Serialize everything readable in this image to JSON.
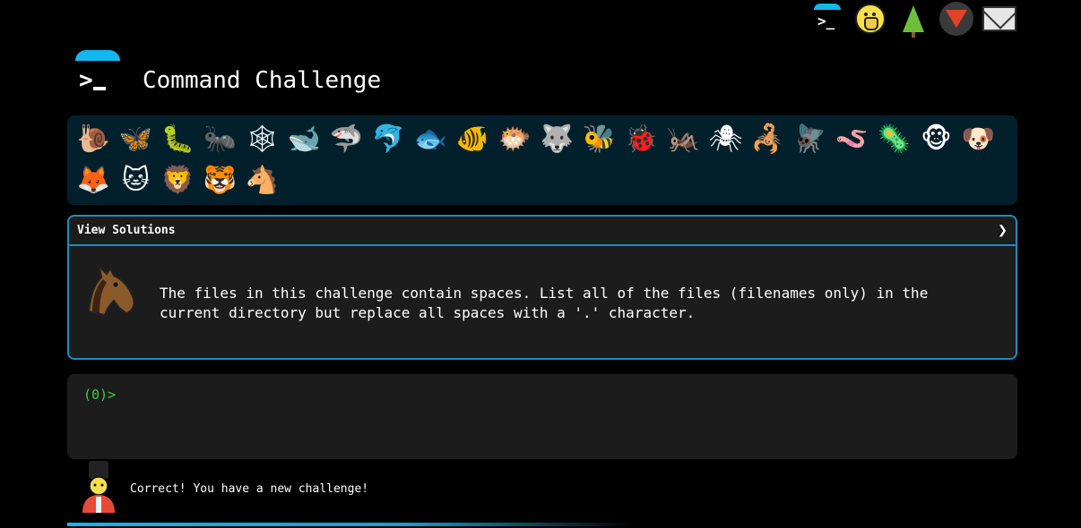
{
  "top_icons": [
    {
      "name": "terminal-icon",
      "label": ">_"
    },
    {
      "name": "shushing-face-icon"
    },
    {
      "name": "tree-icon"
    },
    {
      "name": "gitlab-icon"
    },
    {
      "name": "mail-icon"
    }
  ],
  "header": {
    "title": "Command Challenge",
    "logo_prompt": ">"
  },
  "animals": [
    {
      "name": "snail-icon",
      "glyph": "🐌"
    },
    {
      "name": "butterfly-icon",
      "glyph": "🦋"
    },
    {
      "name": "caterpillar-icon",
      "glyph": "🐛"
    },
    {
      "name": "ant-icon",
      "glyph": "🐜"
    },
    {
      "name": "spider-web-icon",
      "glyph": "🕸"
    },
    {
      "name": "whale-icon",
      "glyph": "🐋"
    },
    {
      "name": "shark-icon",
      "glyph": "🦈"
    },
    {
      "name": "dolphin-icon",
      "glyph": "🐬"
    },
    {
      "name": "fish-icon",
      "glyph": "🐟"
    },
    {
      "name": "tropical-fish-icon",
      "glyph": "🐠"
    },
    {
      "name": "blowfish-icon",
      "glyph": "🐡"
    },
    {
      "name": "wolf-icon",
      "glyph": "🐺"
    },
    {
      "name": "bee-icon",
      "glyph": "🐝"
    },
    {
      "name": "ladybug-icon",
      "glyph": "🐞"
    },
    {
      "name": "cricket-icon",
      "glyph": "🦗"
    },
    {
      "name": "spider-icon",
      "glyph": "🕷"
    },
    {
      "name": "scorpion-icon",
      "glyph": "🦂"
    },
    {
      "name": "fly-icon",
      "glyph": "🪰"
    },
    {
      "name": "worm-icon",
      "glyph": "🪱"
    },
    {
      "name": "microbe-icon",
      "glyph": "🦠"
    },
    {
      "name": "monkey-icon",
      "glyph": "🐵"
    },
    {
      "name": "dog-icon",
      "glyph": "🐶"
    },
    {
      "name": "fox-icon",
      "glyph": "🦊"
    },
    {
      "name": "cat-icon",
      "glyph": "🐱"
    },
    {
      "name": "lion-icon",
      "glyph": "🦁"
    },
    {
      "name": "tiger-icon",
      "glyph": "🐯"
    },
    {
      "name": "horse-icon",
      "glyph": "🐴"
    }
  ],
  "challenge": {
    "view_solutions_label": "View Solutions",
    "chevron": "❯",
    "text": "The files in this challenge contain spaces. List all of the files (filenames only) in the current directory but replace all spaces with a '.' character.",
    "avatar": "horse-icon"
  },
  "terminal": {
    "prompt": "(0)>"
  },
  "status": {
    "message": "Correct! You have a new challenge!",
    "avatar": "guard-icon"
  },
  "colors": {
    "accent": "#12b7ec",
    "panel_border": "#1d8dbf",
    "animals_bg": "#02202b",
    "panel_bg": "#1c1c1c",
    "prompt_green": "#3ad13a"
  }
}
